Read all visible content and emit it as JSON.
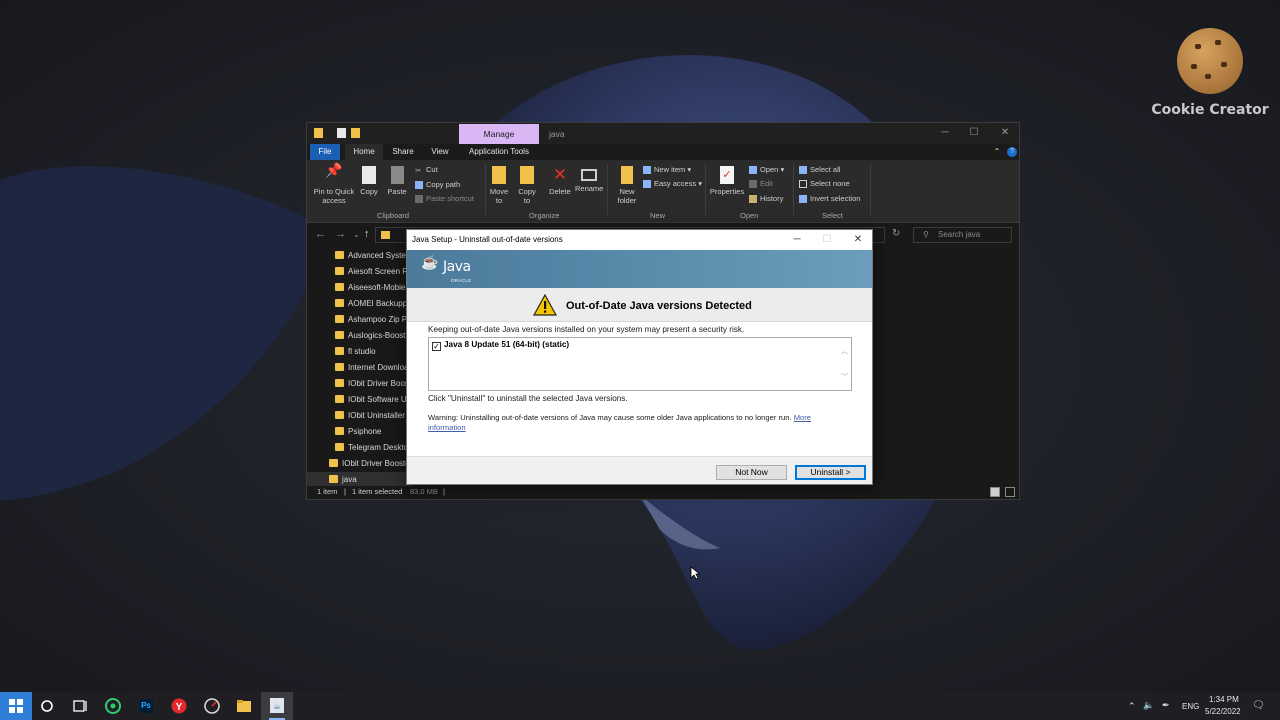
{
  "watermark": {
    "text": "Cookie Creator"
  },
  "explorer": {
    "title": "java",
    "manage_tab": "Manage",
    "tabs": [
      "File",
      "Home",
      "Share",
      "View",
      "Application Tools"
    ],
    "ribbon": {
      "clipboard": {
        "pin": "Pin to Quick access",
        "copy": "Copy",
        "paste": "Paste",
        "cut": "Cut",
        "copy_path": "Copy path",
        "paste_shortcut": "Paste shortcut",
        "group": "Clipboard"
      },
      "organize": {
        "move_to": "Move to",
        "copy_to": "Copy to",
        "delete": "Delete",
        "rename": "Rename",
        "group": "Organize"
      },
      "new": {
        "new_folder": "New folder",
        "new_item": "New item",
        "easy_access": "Easy access",
        "group": "New"
      },
      "open": {
        "properties": "Properties",
        "open": "Open",
        "edit": "Edit",
        "history": "History",
        "group": "Open"
      },
      "select": {
        "select_all": "Select all",
        "select_none": "Select none",
        "invert": "Invert selection",
        "group": "Select"
      }
    },
    "search_placeholder": "Search java",
    "folders": [
      "Advanced SystemCare",
      "Aiesoft Screen Recorder",
      "Aiseesoft-MobieSync",
      "AOMEI Backupper",
      "Ashampoo Zip Pro",
      "Auslogics-BoostSpeed",
      "fl studio",
      "Internet Download Manager",
      "IObit Driver Booster",
      "IObit Software Updater",
      "IObit Uninstaller",
      "Psiphone",
      "Telegram Desktop",
      "IObit Driver Booster",
      "java"
    ],
    "status": {
      "items": "1 item",
      "selected": "1 item selected",
      "size": "83.0 MB"
    }
  },
  "dialog": {
    "title": "Java Setup - Uninstall out-of-date versions",
    "logo_text": "Java",
    "logo_sub": "ORACLE",
    "heading": "Out-of-Date Java versions Detected",
    "intro": "Keeping out-of-date Java versions installed on your system may present a security risk.",
    "list_item": "Java 8 Update 51 (64-bit) (static)",
    "instruction": "Click \"Uninstall\" to uninstall the selected Java versions.",
    "warning": "Warning: Uninstalling out-of-date versions of Java may cause some older Java applications to no longer run.",
    "more_info_1": "More",
    "more_info_2": "information",
    "btn_not_now": "Not Now",
    "btn_uninstall": "Uninstall >"
  },
  "taskbar": {
    "icons": [
      "start-icon",
      "cortana-icon",
      "task-view-icon",
      "app-green-icon",
      "photoshop-icon",
      "yandex-icon",
      "speed-icon",
      "file-explorer-icon",
      "java-setup-icon"
    ],
    "ps_label": "Ps",
    "lang": "ENG",
    "time": "1:34 PM",
    "date": "5/22/2022"
  },
  "colors": {
    "accent": "#1a5fb4",
    "manage": "#d9b7f4",
    "java_banner": "#5d8eae",
    "wallpaper_blob": "#36446e"
  }
}
